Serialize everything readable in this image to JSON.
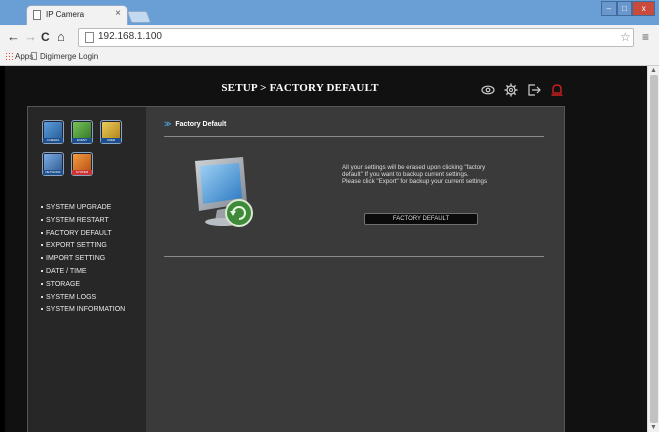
{
  "browser": {
    "tab_title": "IP Camera",
    "tab_close": "×",
    "url": "192.168.1.100",
    "nav": {
      "back": "←",
      "forward": "→",
      "reload": "C",
      "home": "⌂"
    },
    "bookmarks": [
      {
        "label": "Apps"
      },
      {
        "label": "Digimerge Login"
      }
    ],
    "window_controls": {
      "minimize": "–",
      "maximize": "□",
      "close": "x"
    },
    "star": "☆",
    "menu": "≡"
  },
  "header": {
    "title": "SETUP > FACTORY DEFAULT",
    "icons": [
      "eye-icon",
      "gear-icon",
      "logout-icon",
      "alarm-bell-icon"
    ],
    "colors": {
      "icon": "#cccccc",
      "alarm": "#e02020"
    }
  },
  "sidebar": {
    "categories": [
      {
        "name": "camera",
        "caption": "CAMERA",
        "color": "#3b7fc4"
      },
      {
        "name": "event",
        "caption": "EVENT",
        "color": "#4a9e3a"
      },
      {
        "name": "user",
        "caption": "USER",
        "color": "#d4a020"
      },
      {
        "name": "network",
        "caption": "NETWORK",
        "color": "#3a6fb0"
      },
      {
        "name": "system",
        "caption": "SYSTEM",
        "color": "#e07020"
      }
    ],
    "menu": [
      "SYSTEM UPGRADE",
      "SYSTEM RESTART",
      "FACTORY DEFAULT",
      "EXPORT SETTING",
      "IMPORT SETTING",
      "DATE / TIME",
      "STORAGE",
      "SYSTEM LOGS",
      "SYSTEM INFORMATION"
    ]
  },
  "main": {
    "section_title": "Factory Default",
    "message_lines": [
      "All your settings will be erased upon clicking \"factory",
      "default\" If you want to backup current settings.",
      "Please click \"Export\" for backup your current settings"
    ],
    "button_label": "FACTORY DEFAULT"
  }
}
